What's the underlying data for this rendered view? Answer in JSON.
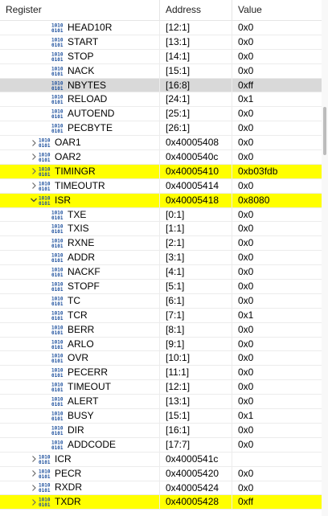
{
  "header": {
    "register": "Register",
    "address": "Address",
    "value": "Value"
  },
  "rows": [
    {
      "name": "HEAD10R",
      "address": "[12:1]",
      "value": "0x0",
      "indent": 1,
      "expander": "none",
      "state": "normal"
    },
    {
      "name": "START",
      "address": "[13:1]",
      "value": "0x0",
      "indent": 1,
      "expander": "none",
      "state": "normal"
    },
    {
      "name": "STOP",
      "address": "[14:1]",
      "value": "0x0",
      "indent": 1,
      "expander": "none",
      "state": "normal"
    },
    {
      "name": "NACK",
      "address": "[15:1]",
      "value": "0x0",
      "indent": 1,
      "expander": "none",
      "state": "normal"
    },
    {
      "name": "NBYTES",
      "address": "[16:8]",
      "value": "0xff",
      "indent": 1,
      "expander": "none",
      "state": "selected"
    },
    {
      "name": "RELOAD",
      "address": "[24:1]",
      "value": "0x1",
      "indent": 1,
      "expander": "none",
      "state": "normal"
    },
    {
      "name": "AUTOEND",
      "address": "[25:1]",
      "value": "0x0",
      "indent": 1,
      "expander": "none",
      "state": "normal"
    },
    {
      "name": "PECBYTE",
      "address": "[26:1]",
      "value": "0x0",
      "indent": 1,
      "expander": "none",
      "state": "normal"
    },
    {
      "name": "OAR1",
      "address": "0x40005408",
      "value": "0x0",
      "indent": 0,
      "expander": "collapsed",
      "state": "normal"
    },
    {
      "name": "OAR2",
      "address": "0x4000540c",
      "value": "0x0",
      "indent": 0,
      "expander": "collapsed",
      "state": "normal"
    },
    {
      "name": "TIMINGR",
      "address": "0x40005410",
      "value": "0xb03fdb",
      "indent": 0,
      "expander": "collapsed",
      "state": "highlight"
    },
    {
      "name": "TIMEOUTR",
      "address": "0x40005414",
      "value": "0x0",
      "indent": 0,
      "expander": "collapsed",
      "state": "normal"
    },
    {
      "name": "ISR",
      "address": "0x40005418",
      "value": "0x8080",
      "indent": 0,
      "expander": "expanded",
      "state": "highlight"
    },
    {
      "name": "TXE",
      "address": "[0:1]",
      "value": "0x0",
      "indent": 1,
      "expander": "none",
      "state": "normal"
    },
    {
      "name": "TXIS",
      "address": "[1:1]",
      "value": "0x0",
      "indent": 1,
      "expander": "none",
      "state": "normal"
    },
    {
      "name": "RXNE",
      "address": "[2:1]",
      "value": "0x0",
      "indent": 1,
      "expander": "none",
      "state": "normal"
    },
    {
      "name": "ADDR",
      "address": "[3:1]",
      "value": "0x0",
      "indent": 1,
      "expander": "none",
      "state": "normal"
    },
    {
      "name": "NACKF",
      "address": "[4:1]",
      "value": "0x0",
      "indent": 1,
      "expander": "none",
      "state": "normal"
    },
    {
      "name": "STOPF",
      "address": "[5:1]",
      "value": "0x0",
      "indent": 1,
      "expander": "none",
      "state": "normal"
    },
    {
      "name": "TC",
      "address": "[6:1]",
      "value": "0x0",
      "indent": 1,
      "expander": "none",
      "state": "normal"
    },
    {
      "name": "TCR",
      "address": "[7:1]",
      "value": "0x1",
      "indent": 1,
      "expander": "none",
      "state": "normal"
    },
    {
      "name": "BERR",
      "address": "[8:1]",
      "value": "0x0",
      "indent": 1,
      "expander": "none",
      "state": "normal"
    },
    {
      "name": "ARLO",
      "address": "[9:1]",
      "value": "0x0",
      "indent": 1,
      "expander": "none",
      "state": "normal"
    },
    {
      "name": "OVR",
      "address": "[10:1]",
      "value": "0x0",
      "indent": 1,
      "expander": "none",
      "state": "normal"
    },
    {
      "name": "PECERR",
      "address": "[11:1]",
      "value": "0x0",
      "indent": 1,
      "expander": "none",
      "state": "normal"
    },
    {
      "name": "TIMEOUT",
      "address": "[12:1]",
      "value": "0x0",
      "indent": 1,
      "expander": "none",
      "state": "normal"
    },
    {
      "name": "ALERT",
      "address": "[13:1]",
      "value": "0x0",
      "indent": 1,
      "expander": "none",
      "state": "normal"
    },
    {
      "name": "BUSY",
      "address": "[15:1]",
      "value": "0x1",
      "indent": 1,
      "expander": "none",
      "state": "normal"
    },
    {
      "name": "DIR",
      "address": "[16:1]",
      "value": "0x0",
      "indent": 1,
      "expander": "none",
      "state": "normal"
    },
    {
      "name": "ADDCODE",
      "address": "[17:7]",
      "value": "0x0",
      "indent": 1,
      "expander": "none",
      "state": "normal"
    },
    {
      "name": "ICR",
      "address": "0x4000541c",
      "value": "",
      "indent": 0,
      "expander": "collapsed",
      "state": "normal"
    },
    {
      "name": "PECR",
      "address": "0x40005420",
      "value": "0x0",
      "indent": 0,
      "expander": "collapsed",
      "state": "normal"
    },
    {
      "name": "RXDR",
      "address": "0x40005424",
      "value": "0x0",
      "indent": 0,
      "expander": "collapsed",
      "state": "normal"
    },
    {
      "name": "TXDR",
      "address": "0x40005428",
      "value": "0xff",
      "indent": 0,
      "expander": "collapsed",
      "state": "highlight"
    }
  ],
  "icons": {
    "register": "binary-register-icon",
    "collapsed": "chevron-right-icon",
    "expanded": "chevron-down-icon"
  },
  "colors": {
    "highlight": "#ffff00",
    "selected": "#d9d9d9",
    "icon_blue": "#1c4f9c"
  }
}
